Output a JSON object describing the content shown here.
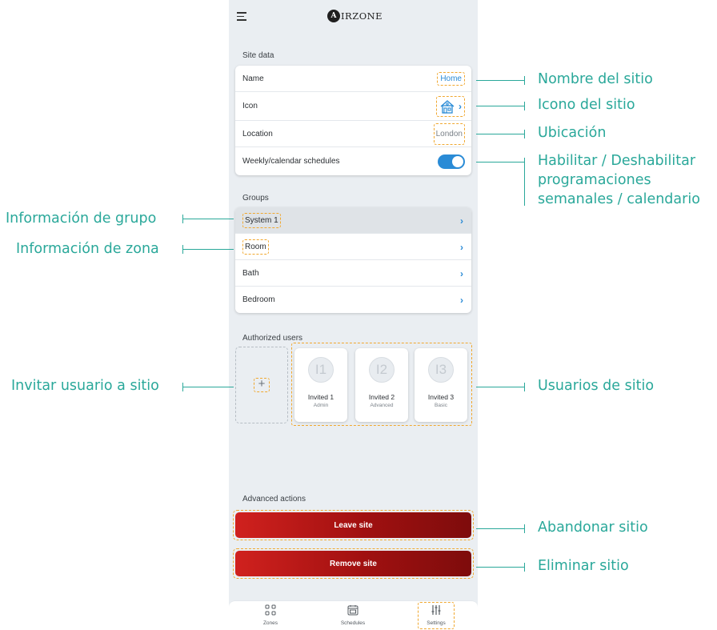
{
  "app": {
    "logo_letter": "A",
    "logo_text": "IRZONE"
  },
  "site_data": {
    "section_label": "Site data",
    "rows": [
      {
        "label": "Name",
        "value": "Home"
      },
      {
        "label": "Icon",
        "icon": "house-icon"
      },
      {
        "label": "Location",
        "value": "London"
      },
      {
        "label": "Weekly/calendar schedules",
        "toggle_on": true
      }
    ]
  },
  "groups": {
    "section_label": "Groups",
    "items": [
      {
        "label": "System 1"
      },
      {
        "label": "Room"
      },
      {
        "label": "Bath"
      },
      {
        "label": "Bedroom"
      }
    ]
  },
  "authorized_users": {
    "section_label": "Authorized users",
    "invite_symbol": "+",
    "users": [
      {
        "initials": "I1",
        "name": "Invited 1",
        "role": "Admin"
      },
      {
        "initials": "I2",
        "name": "Invited 2",
        "role": "Advanced"
      },
      {
        "initials": "I3",
        "name": "Invited 3",
        "role": "Basic"
      }
    ]
  },
  "advanced_actions": {
    "section_label": "Advanced actions",
    "leave_label": "Leave site",
    "remove_label": "Remove site"
  },
  "nav": {
    "items": [
      {
        "label": "Zones",
        "icon": "grid-icon"
      },
      {
        "label": "Schedules",
        "icon": "calendar-icon"
      },
      {
        "label": "Settings",
        "icon": "sliders-icon"
      }
    ]
  },
  "annotations": {
    "site_name": "Nombre del sitio",
    "site_icon": "Icono del sitio",
    "location": "Ubicación",
    "schedules_line1": "Habilitar / Deshabilitar",
    "schedules_line2": "programaciones",
    "schedules_line3": "semanales / calendario",
    "group_info": "Información de grupo",
    "zone_info": "Información de zona",
    "invite_user": "Invitar usuario a  sitio",
    "site_users": "Usuarios de sitio",
    "leave_site": "Abandonar sitio",
    "remove_site": "Eliminar sitio"
  },
  "colors": {
    "accent": "#2a8bd6",
    "annotation": "#2aa89a",
    "highlight_dash": "#f0a830",
    "danger": "#b01414"
  }
}
